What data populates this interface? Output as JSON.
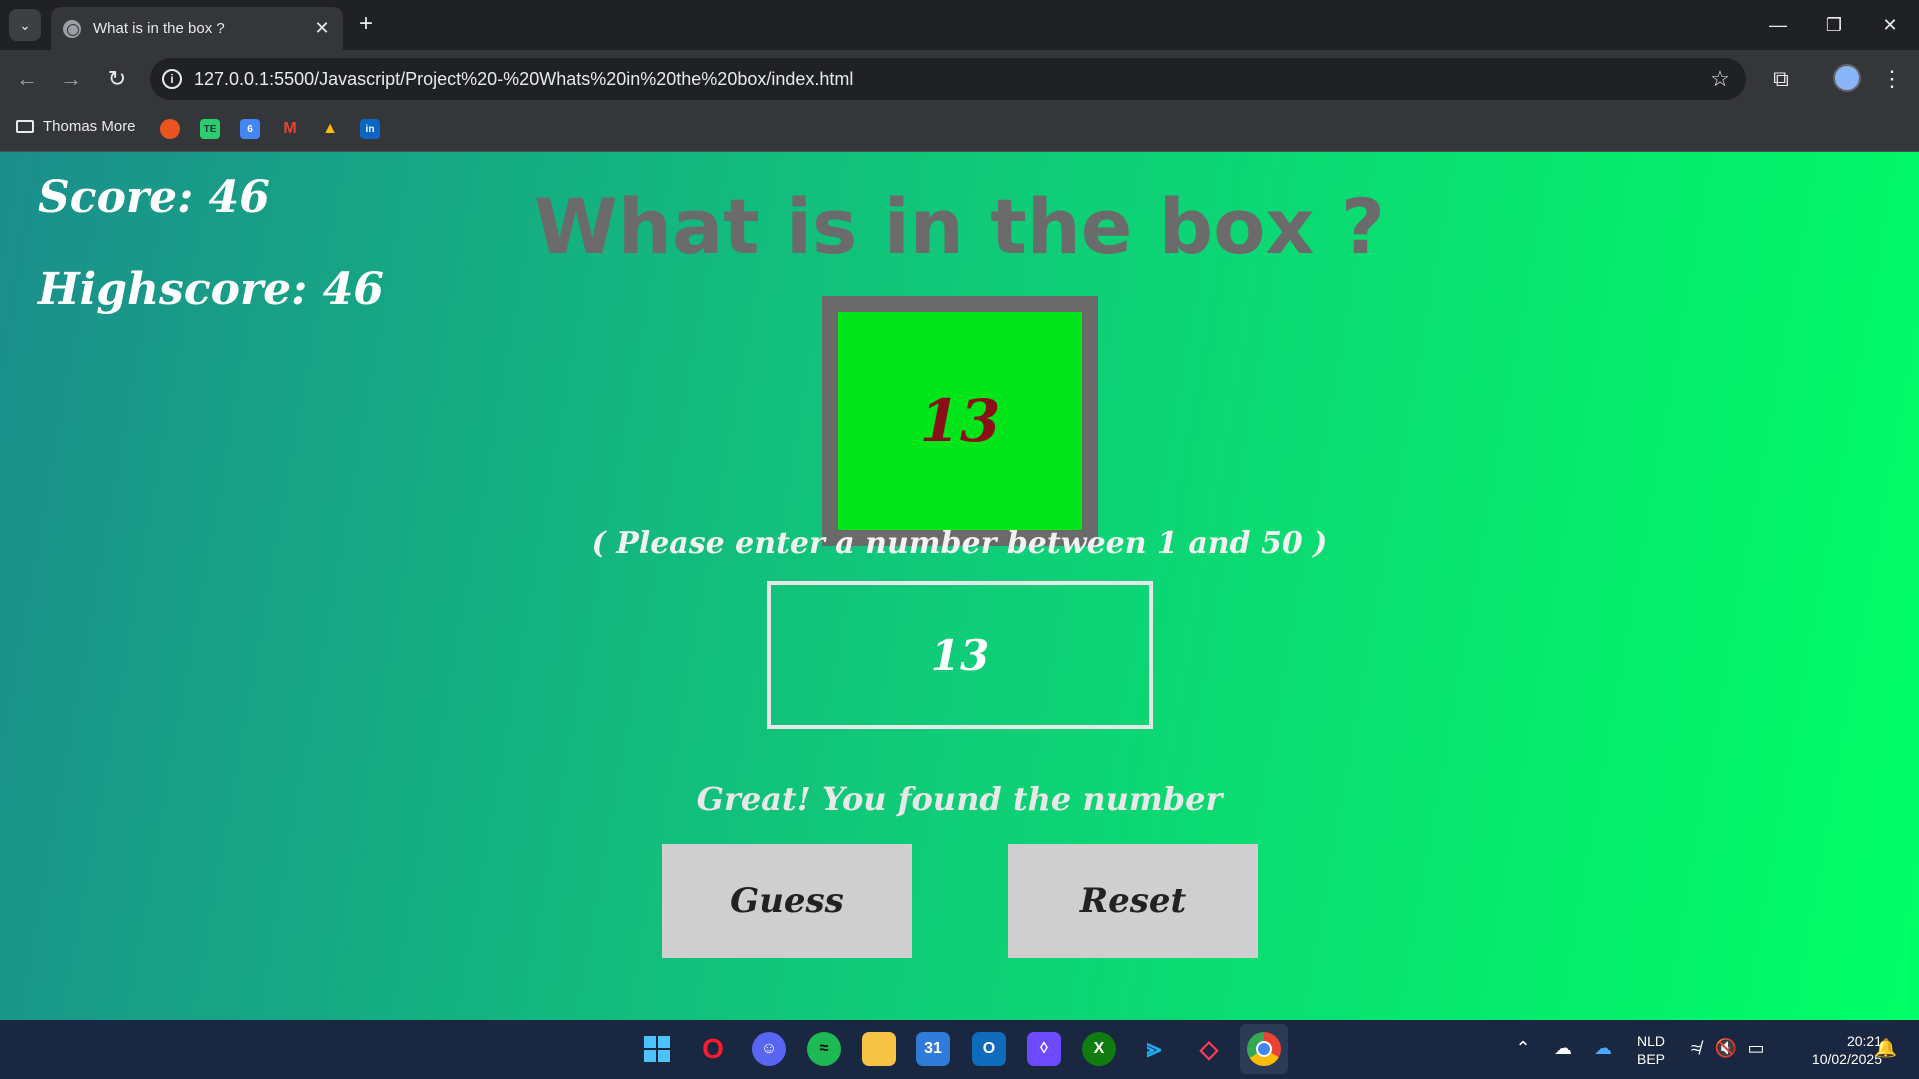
{
  "browser": {
    "tab_title": "What is in the box ?",
    "tab_close": "✕",
    "new_tab": "+",
    "url": "127.0.0.1:5500/Javascript/Project%20-%20Whats%20in%20the%20box/index.html",
    "bookmark_folder": "Thomas More",
    "bookmark_icons": [
      "ubuntu-icon",
      "te-icon",
      "calendar-icon",
      "gmail-icon",
      "drive-icon",
      "linkedin-icon"
    ]
  },
  "game": {
    "score_label": "Score: 46",
    "highscore_label": "Highscore: 46",
    "heading": "What is in the box ?",
    "secret_number": "13",
    "hint": "( Please enter a number between 1 and 50 )",
    "input_value": "13",
    "message": "Great! You found the number",
    "guess_label": "Guess",
    "reset_label": "Reset",
    "colors": {
      "heading": "#6b6b6b",
      "box_frame": "#6a6a6a",
      "box_fill": "#00e61a",
      "secret_number": "#8b0f18",
      "button": "#cfcfcf"
    }
  },
  "taskbar": {
    "apps": [
      "windows-start-icon",
      "opera-icon",
      "discord-icon",
      "spotify-icon",
      "file-explorer-icon",
      "calendar-icon",
      "outlook-icon",
      "proton-icon",
      "xbox-icon",
      "vscode-icon",
      "app-icon",
      "chrome-icon"
    ],
    "language": "NLD",
    "keyboard": "BEP",
    "time": "20:21",
    "date": "10/02/2025"
  }
}
